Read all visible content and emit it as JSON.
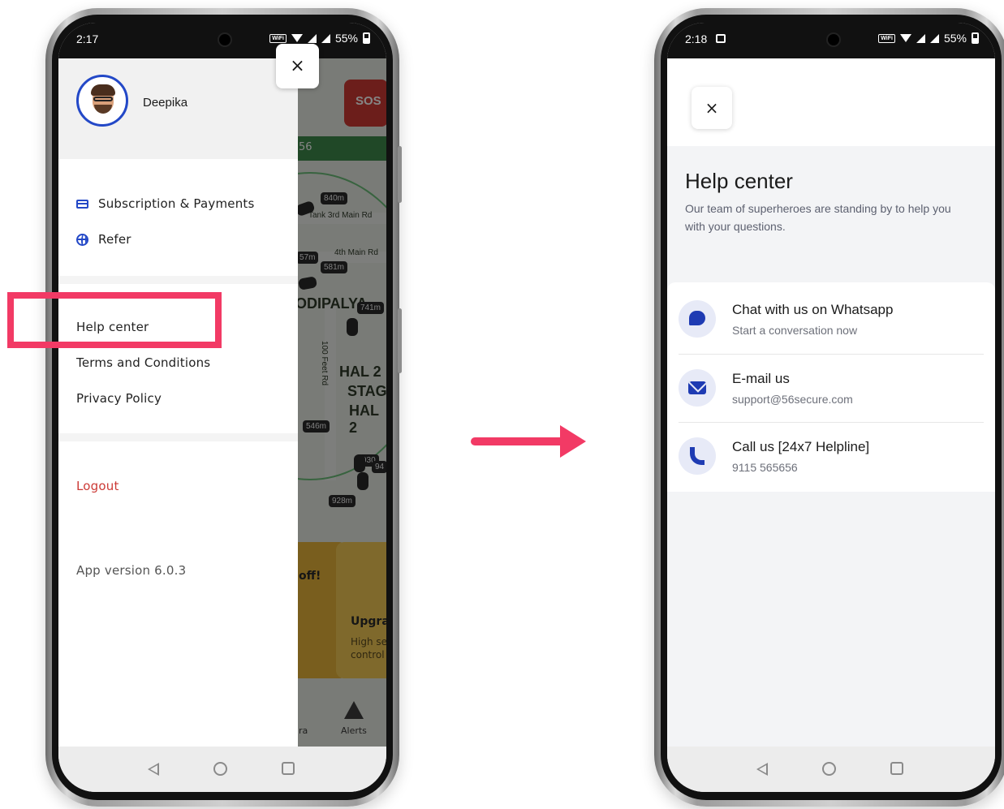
{
  "left_phone": {
    "status": {
      "time": "2:17",
      "wifi_call": "WiFi",
      "battery": "55%"
    },
    "drawer": {
      "user_name": "Deepika",
      "close_label": "×",
      "items": [
        {
          "label": "Subscription & Payments",
          "icon": "card-icon"
        },
        {
          "label": "Refer",
          "icon": "globe-icon"
        }
      ],
      "info_items": [
        "Help center",
        "Terms and Conditions",
        "Privacy Policy"
      ],
      "logout": "Logout",
      "version": "App version 6.0.3"
    },
    "map": {
      "sos": "SOS",
      "eta_strip": "56",
      "distances": [
        "840m",
        "581m",
        "741m",
        "546m",
        "928m",
        "57m",
        "930",
        "94"
      ],
      "roads": [
        "Tank 3rd Main Rd",
        "4th Main Rd",
        "100 Feet Rd"
      ],
      "area_names": [
        "ODIPALYA",
        "HAL 2",
        "STAG",
        "HAL 2"
      ],
      "card_texts": [
        "off!",
        "Upgra",
        "High se",
        "control"
      ],
      "tabs": [
        "ra",
        "Alerts"
      ]
    }
  },
  "right_phone": {
    "status": {
      "time": "2:18",
      "wifi_call": "WiFi",
      "battery": "55%"
    },
    "close_label": "×",
    "title": "Help center",
    "subtitle": "Our team of superheroes are standing by to help you with your questions.",
    "options": [
      {
        "title": "Chat with us on Whatsapp",
        "sub": "Start a conversation now",
        "icon": "chat-icon"
      },
      {
        "title": "E-mail us",
        "sub": "support@56secure.com",
        "icon": "mail-icon"
      },
      {
        "title": "Call us [24x7 Helpline]",
        "sub": "9115 565656",
        "icon": "phone-icon"
      }
    ]
  },
  "colors": {
    "accent_blue": "#2348c7",
    "highlight": "#f23a65",
    "logout_red": "#cc3a36"
  }
}
